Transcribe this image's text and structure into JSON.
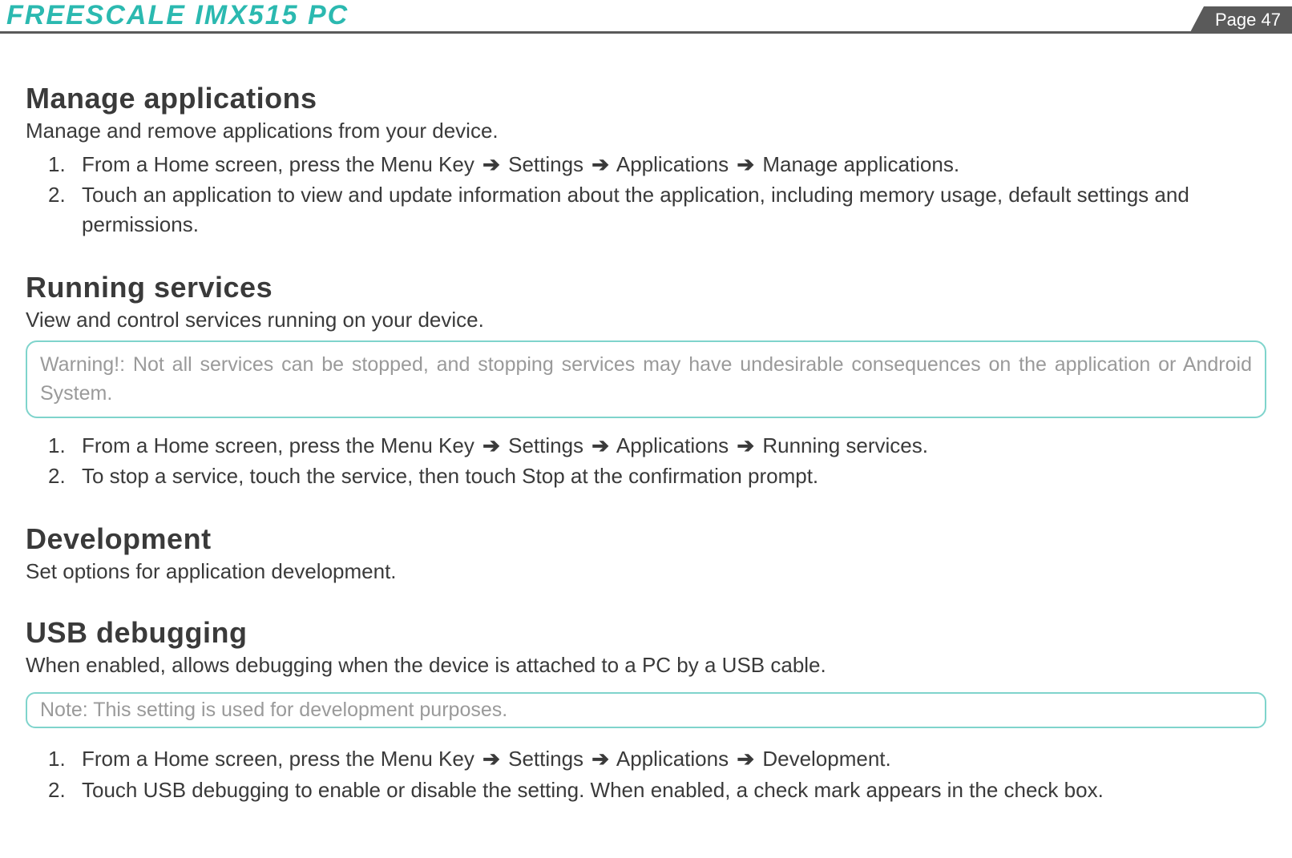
{
  "header": {
    "title": "FREESCALE  IMX515  PC",
    "page_label": "Page",
    "page_number": "47"
  },
  "sections": {
    "manage_apps": {
      "title": "Manage applications",
      "desc": "Manage and remove applications from your device.",
      "item1_pre": "From a Home screen, press the Menu Key ",
      "item1_a": " Settings ",
      "item1_b": " Applications ",
      "item1_c": " Manage applications.",
      "item2": "Touch an application to view and update information about the application, including memory usage, default settings and permissions."
    },
    "running_services": {
      "title": "Running services",
      "desc": "View and control services running on your device.",
      "warning": "Warning!: Not all services can be stopped, and stopping services may have undesirable consequences on the application or Android System.",
      "item1_pre": "From a Home screen, press the Menu Key  ",
      "item1_a": " Settings ",
      "item1_b": " Applications ",
      "item1_c": " Running services.",
      "item2": "To stop a service, touch the service, then touch Stop at the confirmation prompt."
    },
    "development": {
      "title": "Development",
      "desc": "Set options for application development."
    },
    "usb_debugging": {
      "title": "USB debugging",
      "desc": "When enabled, allows debugging when the device is attached to a PC by a USB cable.",
      "note": "Note: This setting is used for development purposes.",
      "item1_pre": "From a Home screen, press the Menu Key  ",
      "item1_a": " Settings ",
      "item1_b": " Applications ",
      "item1_c": " Development.",
      "item2": "Touch USB debugging  to enable or disable the setting. When enabled, a check mark appears in the check box."
    }
  },
  "glyphs": {
    "arrow": "➔"
  }
}
